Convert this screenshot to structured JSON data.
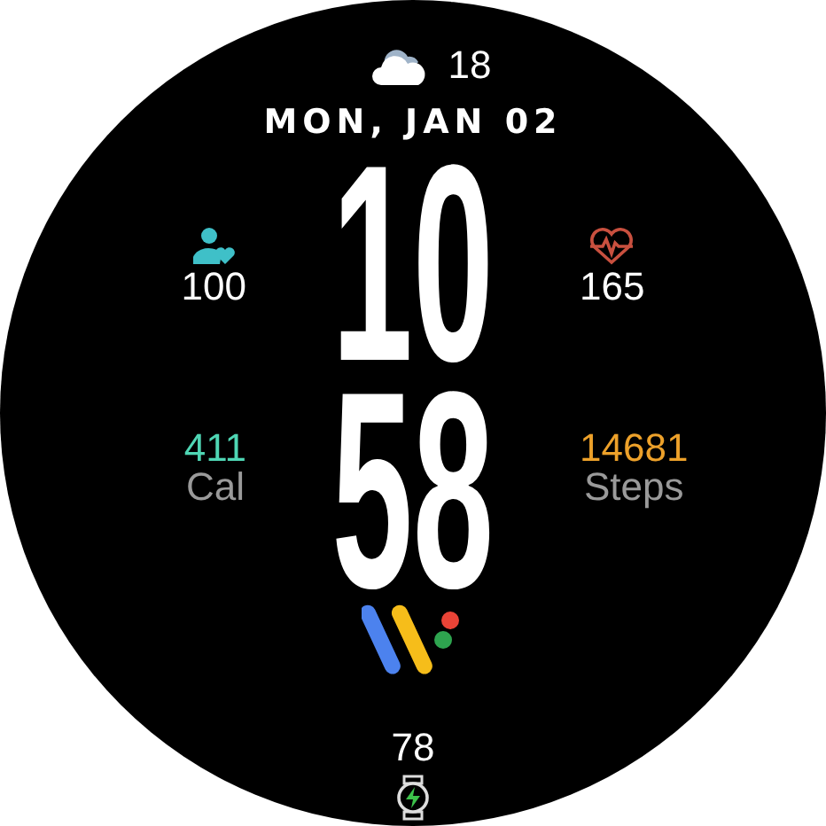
{
  "weather": {
    "temperature": "18"
  },
  "date": "MON, JAN 02",
  "time": {
    "hours": "10",
    "minutes": "58"
  },
  "complications": [
    {
      "kind": "friends",
      "value": "100"
    },
    {
      "kind": "heartrate",
      "value": "165"
    },
    {
      "kind": "value_label",
      "value": "411",
      "label": "Cal",
      "color": "#4fd6b4"
    },
    {
      "kind": "value_label",
      "value": "14681",
      "label": "Steps",
      "color": "#eda12a"
    }
  ],
  "battery": {
    "value": "78"
  }
}
